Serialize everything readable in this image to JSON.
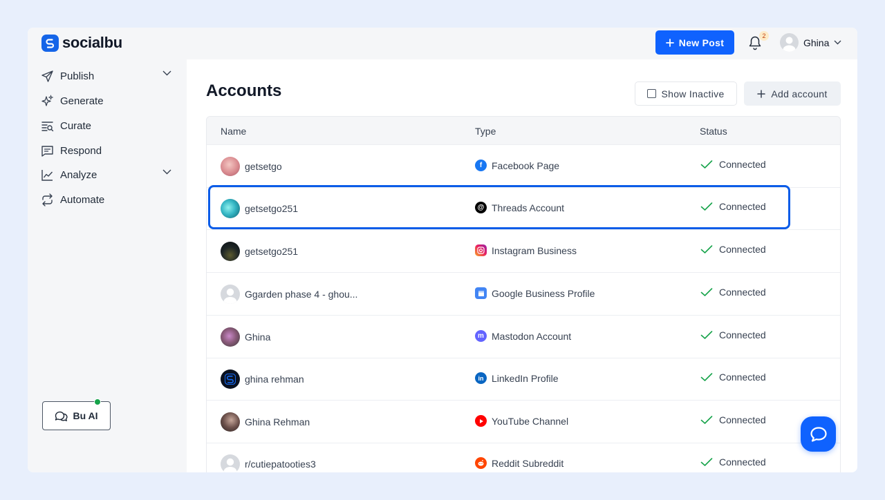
{
  "brand": {
    "name": "socialbu",
    "color": "#1565e8"
  },
  "header": {
    "new_post_label": "New Post",
    "notification_count": "2",
    "user_name": "Ghina"
  },
  "sidebar": {
    "items": [
      {
        "label": "Publish",
        "icon": "send-icon",
        "has_submenu": true
      },
      {
        "label": "Generate",
        "icon": "sparkles-icon",
        "has_submenu": false
      },
      {
        "label": "Curate",
        "icon": "curate-icon",
        "has_submenu": false
      },
      {
        "label": "Respond",
        "icon": "message-icon",
        "has_submenu": false
      },
      {
        "label": "Analyze",
        "icon": "chart-icon",
        "has_submenu": true
      },
      {
        "label": "Automate",
        "icon": "repeat-icon",
        "has_submenu": false
      }
    ],
    "bu_ai_label": "Bu AI"
  },
  "main": {
    "title": "Accounts",
    "show_inactive_label": "Show Inactive",
    "add_account_label": "Add account",
    "columns": [
      "Name",
      "Type",
      "Status"
    ],
    "rows": [
      {
        "name": "getsetgo",
        "type": "Facebook Page",
        "status": "Connected",
        "network": "facebook"
      },
      {
        "name": "getsetgo251",
        "type": "Threads Account",
        "status": "Connected",
        "network": "threads"
      },
      {
        "name": "getsetgo251",
        "type": "Instagram Business",
        "status": "Connected",
        "network": "instagram"
      },
      {
        "name": "Ggarden phase 4 - ghou...",
        "type": "Google Business Profile",
        "status": "Connected",
        "network": "google"
      },
      {
        "name": "Ghina",
        "type": "Mastodon Account",
        "status": "Connected",
        "network": "mastodon"
      },
      {
        "name": "ghina rehman",
        "type": "LinkedIn Profile",
        "status": "Connected",
        "network": "linkedin"
      },
      {
        "name": "Ghina Rehman",
        "type": "YouTube Channel",
        "status": "Connected",
        "network": "youtube"
      },
      {
        "name": "r/cutiepatooties3",
        "type": "Reddit Subreddit",
        "status": "Connected",
        "network": "reddit"
      }
    ],
    "highlighted_row": 1
  },
  "colors": {
    "primary": "#0f62fe",
    "connected_check": "#16a34a",
    "highlight_border": "#0b5ce8"
  }
}
